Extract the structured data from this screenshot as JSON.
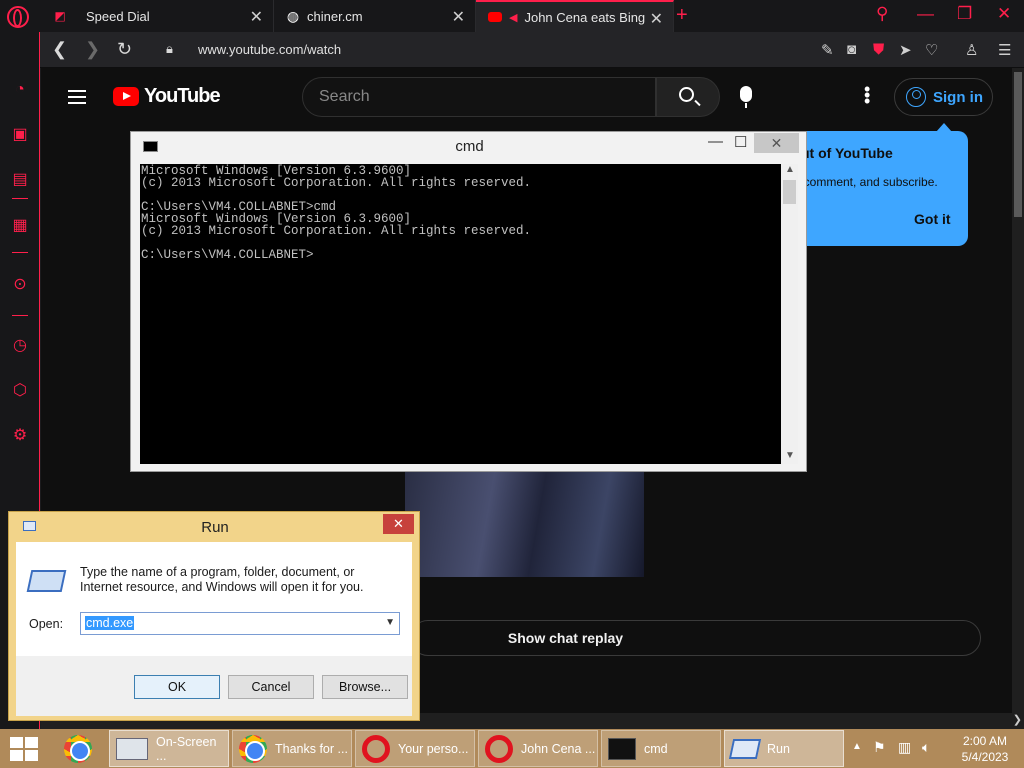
{
  "browser": {
    "tabs": [
      {
        "label": "Speed Dial",
        "icon": "speed-dial-icon"
      },
      {
        "label": "chiner.cm",
        "icon": "globe-icon"
      },
      {
        "label": "John Cena eats Bing Ch",
        "icon": "youtube-icon",
        "active": true
      }
    ],
    "url": "www.youtube.com/watch",
    "accent_color": "#ff1f4b"
  },
  "youtube": {
    "logo_text": "YouTube",
    "search_placeholder": "Search",
    "signin_label": "Sign in",
    "popup": {
      "title": "ut of YouTube",
      "body": "s, comment, and subscribe.",
      "button": "Got it"
    },
    "chat_replay_label": "Show chat replay"
  },
  "cmd": {
    "title": "cmd",
    "lines": [
      "Microsoft Windows [Version 6.3.9600]",
      "(c) 2013 Microsoft Corporation. All rights reserved.",
      "",
      "C:\\Users\\VM4.COLLABNET>cmd",
      "Microsoft Windows [Version 6.3.9600]",
      "(c) 2013 Microsoft Corporation. All rights reserved.",
      "",
      "C:\\Users\\VM4.COLLABNET>"
    ]
  },
  "run": {
    "title": "Run",
    "description": "Type the name of a program, folder, document, or Internet resource, and Windows will open it for you.",
    "open_label": "Open:",
    "open_value": "cmd.exe",
    "ok": "OK",
    "cancel": "Cancel",
    "browse": "Browse..."
  },
  "taskbar": {
    "apps": [
      {
        "label": "On-Screen ...",
        "icon": "keyboard-icon"
      },
      {
        "label": "Thanks for ...",
        "icon": "chrome-icon"
      },
      {
        "label": "Your perso...",
        "icon": "opera-icon"
      },
      {
        "label": "John Cena ...",
        "icon": "opera-icon"
      },
      {
        "label": "cmd",
        "icon": "cmd-icon"
      },
      {
        "label": "Run",
        "icon": "run-icon"
      }
    ],
    "time": "2:00 AM",
    "date": "5/4/2023"
  }
}
